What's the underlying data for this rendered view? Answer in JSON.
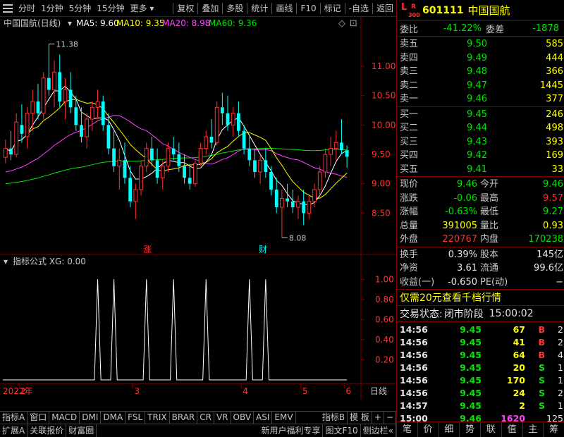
{
  "toolbar": {
    "left": [
      "分时",
      "1分钟",
      "5分钟",
      "15分钟",
      "更多"
    ],
    "right": [
      "复权",
      "叠加",
      "多股",
      "统计",
      "画线",
      "F10",
      "标记",
      "-自选",
      "返回"
    ]
  },
  "chart_header": {
    "name": "中国国航(日线)",
    "ma5": "MA5: 9.60",
    "ma10": "MA10: 9.35",
    "ma20": "MA20: 8.98",
    "ma60": "MA60: 9.36"
  },
  "price_axis": [
    "11.00",
    "10.50",
    "10.00",
    "9.50",
    "9.00",
    "8.50"
  ],
  "high_label": "11.38",
  "low_label": "8.08",
  "markers": {
    "up": "涨",
    "fin": "财"
  },
  "indicator_header": "指标公式  XG: 0.00",
  "indicator_axis": [
    "1.00",
    "0.80",
    "0.60",
    "0.40",
    "0.20"
  ],
  "date_axis": {
    "year": "2022年",
    "months": [
      "2",
      "3",
      "4",
      "5",
      "6"
    ],
    "period": "日线"
  },
  "indicator_tabs": [
    "指标A",
    "窗口",
    "MACD",
    "DMI",
    "DMA",
    "FSL",
    "TRIX",
    "BRAR",
    "CR",
    "VR",
    "OBV",
    "ASI",
    "EMV",
    "指标B",
    "模 板",
    "+",
    "−"
  ],
  "footer_tabs": [
    "扩展A",
    "关联报价",
    "财富圈"
  ],
  "footer_right": [
    "新用户福利专享",
    "图文F10",
    "侧边栏"
  ],
  "stock": {
    "flags_l": "L",
    "flags_r": "R",
    "flags_n": "300",
    "code": "601111",
    "name": "中国国航"
  },
  "wei": {
    "ratio_label": "委比",
    "ratio": "-41.22%",
    "diff_label": "委差",
    "diff": "-1878"
  },
  "asks": [
    {
      "label": "卖五",
      "price": "9.50",
      "vol": "585"
    },
    {
      "label": "卖四",
      "price": "9.49",
      "vol": "444"
    },
    {
      "label": "卖三",
      "price": "9.48",
      "vol": "366"
    },
    {
      "label": "卖二",
      "price": "9.47",
      "vol": "1445"
    },
    {
      "label": "卖一",
      "price": "9.46",
      "vol": "377"
    }
  ],
  "bids": [
    {
      "label": "买一",
      "price": "9.45",
      "vol": "246"
    },
    {
      "label": "买二",
      "price": "9.44",
      "vol": "498"
    },
    {
      "label": "买三",
      "price": "9.43",
      "vol": "393"
    },
    {
      "label": "买四",
      "price": "9.42",
      "vol": "169"
    },
    {
      "label": "买五",
      "price": "9.41",
      "vol": "33"
    }
  ],
  "stats": [
    {
      "l1": "现价",
      "v1": "9.46",
      "c1": "green",
      "l2": "今开",
      "v2": "9.46",
      "c2": "green"
    },
    {
      "l1": "涨跌",
      "v1": "-0.06",
      "c1": "green",
      "l2": "最高",
      "v2": "9.57",
      "c2": "red"
    },
    {
      "l1": "涨幅",
      "v1": "-0.63%",
      "c1": "green",
      "l2": "最低",
      "v2": "9.27",
      "c2": "green"
    },
    {
      "l1": "总量",
      "v1": "391005",
      "c1": "yellow",
      "l2": "量比",
      "v2": "0.93",
      "c2": "yellow"
    },
    {
      "l1": "外盘",
      "v1": "220767",
      "c1": "red",
      "l2": "内盘",
      "v2": "170238",
      "c2": "green"
    }
  ],
  "stats2": [
    {
      "l1": "换手",
      "v1": "0.39%",
      "l2": "股本",
      "v2": "145亿"
    },
    {
      "l1": "净资",
      "v1": "3.61",
      "l2": "流通",
      "v2": "99.6亿"
    },
    {
      "l1": "收益(一)",
      "v1": "-0.650",
      "l2": "PE(动)",
      "v2": "−"
    }
  ],
  "promo": "仅需20元查看千档行情",
  "trade_status": {
    "label": "交易状态:",
    "value": "闭市阶段",
    "time": "15:00:02"
  },
  "ticks": [
    {
      "time": "14:56",
      "price": "9.45",
      "vol": "67",
      "vc": "yellow",
      "side": "B",
      "sc": "red",
      "n": "2"
    },
    {
      "time": "14:56",
      "price": "9.45",
      "vol": "41",
      "vc": "yellow",
      "side": "B",
      "sc": "red",
      "n": "2"
    },
    {
      "time": "14:56",
      "price": "9.45",
      "vol": "64",
      "vc": "yellow",
      "side": "B",
      "sc": "red",
      "n": "4"
    },
    {
      "time": "14:56",
      "price": "9.45",
      "vol": "20",
      "vc": "yellow",
      "side": "S",
      "sc": "green",
      "n": "1"
    },
    {
      "time": "14:56",
      "price": "9.45",
      "vol": "170",
      "vc": "yellow",
      "side": "S",
      "sc": "green",
      "n": "1"
    },
    {
      "time": "14:56",
      "price": "9.45",
      "vol": "24",
      "vc": "yellow",
      "side": "S",
      "sc": "green",
      "n": "2"
    },
    {
      "time": "14:57",
      "price": "9.45",
      "vol": "2",
      "vc": "yellow",
      "side": "S",
      "sc": "green",
      "n": "1"
    },
    {
      "time": "15:00",
      "price": "9.46",
      "vol": "1620",
      "vc": "magenta",
      "side": "",
      "sc": "white",
      "n": "125"
    }
  ],
  "bottom_tabs": [
    "笔",
    "价",
    "细",
    "势",
    "联",
    "值",
    "主",
    "筹"
  ],
  "colors": {
    "up": "#ff3232",
    "down": "#00ffff",
    "ma5": "#ffffff",
    "ma10": "#ffff00",
    "ma20": "#ff40ff",
    "ma60": "#00e600",
    "frame": "#800000"
  },
  "chart_data": {
    "type": "candlestick",
    "title": "中国国航(日线)",
    "ylim": [
      8.0,
      11.6
    ],
    "yticks": [
      8.5,
      9.0,
      9.5,
      10.0,
      10.5,
      11.0
    ],
    "candles": [
      [
        9.45,
        9.75,
        9.35,
        9.6
      ],
      [
        9.6,
        9.9,
        9.4,
        9.5
      ],
      [
        9.5,
        10.2,
        9.45,
        10.05
      ],
      [
        10.0,
        10.35,
        9.7,
        9.85
      ],
      [
        9.8,
        10.3,
        9.6,
        10.2
      ],
      [
        10.2,
        10.6,
        9.9,
        10.4
      ],
      [
        10.4,
        10.7,
        10.1,
        10.2
      ],
      [
        10.2,
        10.9,
        10.1,
        10.8
      ],
      [
        10.8,
        11.38,
        10.5,
        10.6
      ],
      [
        10.6,
        11.1,
        10.3,
        10.9
      ],
      [
        10.9,
        11.2,
        10.3,
        10.4
      ],
      [
        10.4,
        10.8,
        10.1,
        10.6
      ],
      [
        10.6,
        10.9,
        10.2,
        10.3
      ],
      [
        10.3,
        10.5,
        9.9,
        10.0
      ],
      [
        10.0,
        10.3,
        9.7,
        9.8
      ],
      [
        9.8,
        10.2,
        9.6,
        10.1
      ],
      [
        10.1,
        10.4,
        9.9,
        10.3
      ],
      [
        10.3,
        10.6,
        10.1,
        10.4
      ],
      [
        10.4,
        10.5,
        9.9,
        10.0
      ],
      [
        10.0,
        10.2,
        9.5,
        9.6
      ],
      [
        9.6,
        9.9,
        9.2,
        9.3
      ],
      [
        9.3,
        9.6,
        8.9,
        9.4
      ],
      [
        9.4,
        9.7,
        9.0,
        9.1
      ],
      [
        9.1,
        9.3,
        8.6,
        8.7
      ],
      [
        8.7,
        9.0,
        8.4,
        8.9
      ],
      [
        8.9,
        9.4,
        8.8,
        9.3
      ],
      [
        9.3,
        9.7,
        9.2,
        9.6
      ],
      [
        9.6,
        9.8,
        9.3,
        9.4
      ],
      [
        9.4,
        9.6,
        9.0,
        9.1
      ],
      [
        9.1,
        9.4,
        8.9,
        9.3
      ],
      [
        9.3,
        9.7,
        9.2,
        9.6
      ],
      [
        9.6,
        9.8,
        9.4,
        9.5
      ],
      [
        9.5,
        9.7,
        9.2,
        9.3
      ],
      [
        9.3,
        9.5,
        9.0,
        9.1
      ],
      [
        9.1,
        9.3,
        8.9,
        9.0
      ],
      [
        9.0,
        9.4,
        8.95,
        9.35
      ],
      [
        9.35,
        9.7,
        9.3,
        9.6
      ],
      [
        9.6,
        9.9,
        9.5,
        9.8
      ],
      [
        9.8,
        10.1,
        9.6,
        9.7
      ],
      [
        9.7,
        10.4,
        9.65,
        10.3
      ],
      [
        10.3,
        10.55,
        10.0,
        10.2
      ],
      [
        10.2,
        10.5,
        9.9,
        10.0
      ],
      [
        10.0,
        10.3,
        9.8,
        10.2
      ],
      [
        10.2,
        10.4,
        9.8,
        9.9
      ],
      [
        9.9,
        10.0,
        9.5,
        9.6
      ],
      [
        9.6,
        9.8,
        9.3,
        9.4
      ],
      [
        9.4,
        9.6,
        9.1,
        9.2
      ],
      [
        9.2,
        9.5,
        9.0,
        9.4
      ],
      [
        9.4,
        9.6,
        9.1,
        9.2
      ],
      [
        9.2,
        9.3,
        8.8,
        8.9
      ],
      [
        8.9,
        9.1,
        8.5,
        8.6
      ],
      [
        8.6,
        8.9,
        8.08,
        8.75
      ],
      [
        8.75,
        9.0,
        8.6,
        8.7
      ],
      [
        8.7,
        8.9,
        8.5,
        8.6
      ],
      [
        8.6,
        8.8,
        8.4,
        8.7
      ],
      [
        8.7,
        8.9,
        8.3,
        8.5
      ],
      [
        8.5,
        8.8,
        8.4,
        8.7
      ],
      [
        8.7,
        9.0,
        8.6,
        8.9
      ],
      [
        8.9,
        9.3,
        8.8,
        9.2
      ],
      [
        9.2,
        9.6,
        9.1,
        9.5
      ],
      [
        9.5,
        9.8,
        9.3,
        9.6
      ],
      [
        9.6,
        9.9,
        9.4,
        9.7
      ],
      [
        9.7,
        10.1,
        9.5,
        9.57
      ],
      [
        9.57,
        9.65,
        9.27,
        9.46
      ]
    ],
    "indicator": {
      "name": "XG",
      "ylim": [
        0,
        1.1
      ],
      "spikes_at_index": [
        17,
        20,
        26,
        31,
        37,
        45,
        48
      ]
    }
  }
}
